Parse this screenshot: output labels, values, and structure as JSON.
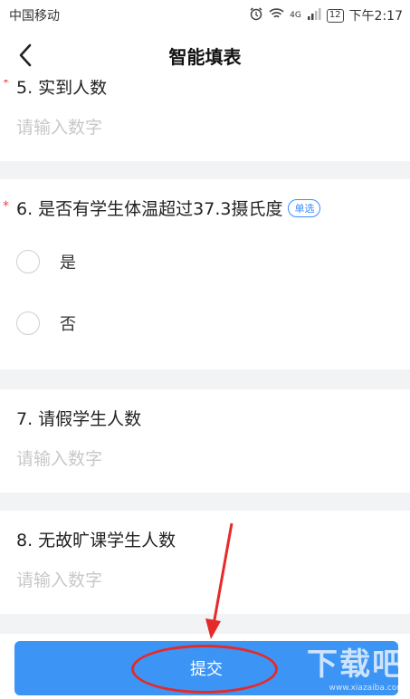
{
  "status_bar": {
    "carrier": "中国移动",
    "signal_text": "4G",
    "battery": "12",
    "time": "下午2:17"
  },
  "nav": {
    "title": "智能填表"
  },
  "questions": [
    {
      "number_title": "5. 实到人数",
      "required_mark": "*",
      "placeholder": "请输入数字"
    },
    {
      "number_title": "6. 是否有学生体温超过37.3摄氏度",
      "required_mark": "*",
      "tag": "单选",
      "options": [
        "是",
        "否"
      ]
    },
    {
      "number_title": "7. 请假学生人数",
      "placeholder": "请输入数字"
    },
    {
      "number_title": "8. 无故旷课学生人数",
      "placeholder": "请输入数字"
    }
  ],
  "submit": {
    "label": "提交"
  },
  "watermark": {
    "main": "下载吧",
    "sub": "www.xiazaiba.com"
  },
  "colors": {
    "accent": "#3c95f5",
    "annotation": "#e52a2a",
    "required": "#ee4444"
  }
}
